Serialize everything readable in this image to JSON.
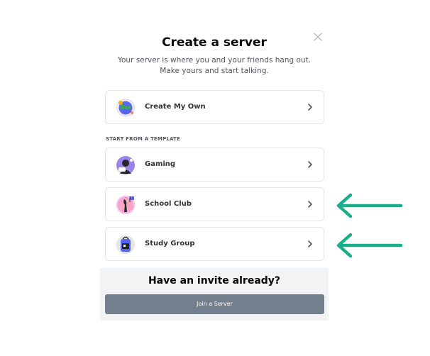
{
  "modal": {
    "title": "Create a server",
    "subtitle": "Your server is where you and your friends hang out. Make yours and start talking.",
    "create_own": {
      "label": "Create My Own",
      "icon": "globe-icon"
    },
    "section_label": "START FROM A TEMPLATE",
    "templates": [
      {
        "label": "Gaming",
        "icon": "gaming-icon"
      },
      {
        "label": "School Club",
        "icon": "school-club-icon"
      },
      {
        "label": "Study Group",
        "icon": "study-group-icon"
      }
    ],
    "footer": {
      "title": "Have an invite already?",
      "join_label": "Join a Server"
    }
  },
  "colors": {
    "annotation_arrow": "#1aaf8b",
    "join_button": "#747f8d",
    "footer_bg": "#f2f3f5"
  }
}
